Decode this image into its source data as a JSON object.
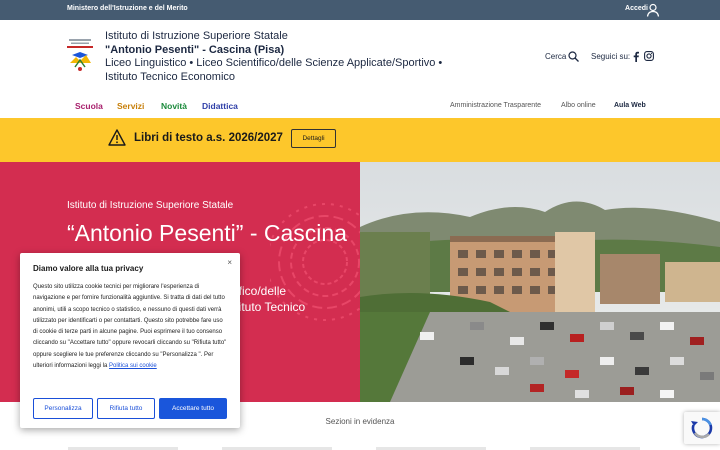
{
  "topbar": {
    "ministry": "Ministero dell'Istruzione e del Merito",
    "login": "Accedi"
  },
  "header": {
    "line1": "Istituto di Istruzione Superiore Statale",
    "line2": "\"Antonio Pesenti\" - Cascina (Pisa)",
    "line3": "Liceo Linguistico • Liceo Scientifico/delle Scienze Applicate/Sportivo • Istituto Tecnico Economico",
    "search_label": "Cerca",
    "follow_label": "Seguici su:"
  },
  "nav": {
    "left": [
      {
        "label": "Scuola",
        "color": "#a8206d"
      },
      {
        "label": "Servizi",
        "color": "#c77f0a"
      },
      {
        "label": "Novità",
        "color": "#1b8a3b"
      },
      {
        "label": "Didattica",
        "color": "#2f3fa8"
      }
    ],
    "right": [
      "Amministrazione Trasparente",
      "Albo online",
      "Aula Web"
    ]
  },
  "alert": {
    "text": "Libri di testo a.s. 2026/2027",
    "button": "Dettagli",
    "color": "#fdc72b"
  },
  "hero": {
    "kicker": "Istituto di Istruzione Superiore Statale",
    "title": "“Antonio Pesenti” - Cascina",
    "subtitle_line1": "ntifico/delle",
    "subtitle_line2": "Istituto Tecnico",
    "color": "#d32d50"
  },
  "below": {
    "sections_label": "Sezioni in evidenza"
  },
  "cookie": {
    "title": "Diamo valore alla tua privacy",
    "close": "×",
    "body": "Questo sito utilizza cookie tecnici per migliorare l'esperienza di navigazione e per fornire funzionalità aggiuntive. Si tratta di dati del tutto anonimi, utili a scopo tecnico o statistico, e nessuno di questi dati verrà utilizzato per identificarti o per contattarti. Questo sito potrebbe fare uso di cookie di terze parti in alcune pagine. Puoi esprimere il tuo consenso cliccando su \"Accettare tutto\" oppure revocarli cliccando su \"Rifiuta tutto\" oppure scegliere le tue preferenze cliccando su \"Personalizza \". Per ulteriori informazioni leggi la ",
    "link": "Politica sui cookie",
    "buttons": {
      "customize": "Personalizza",
      "reject": "Rifiuta tutto",
      "accept": "Accettare tutto"
    }
  }
}
